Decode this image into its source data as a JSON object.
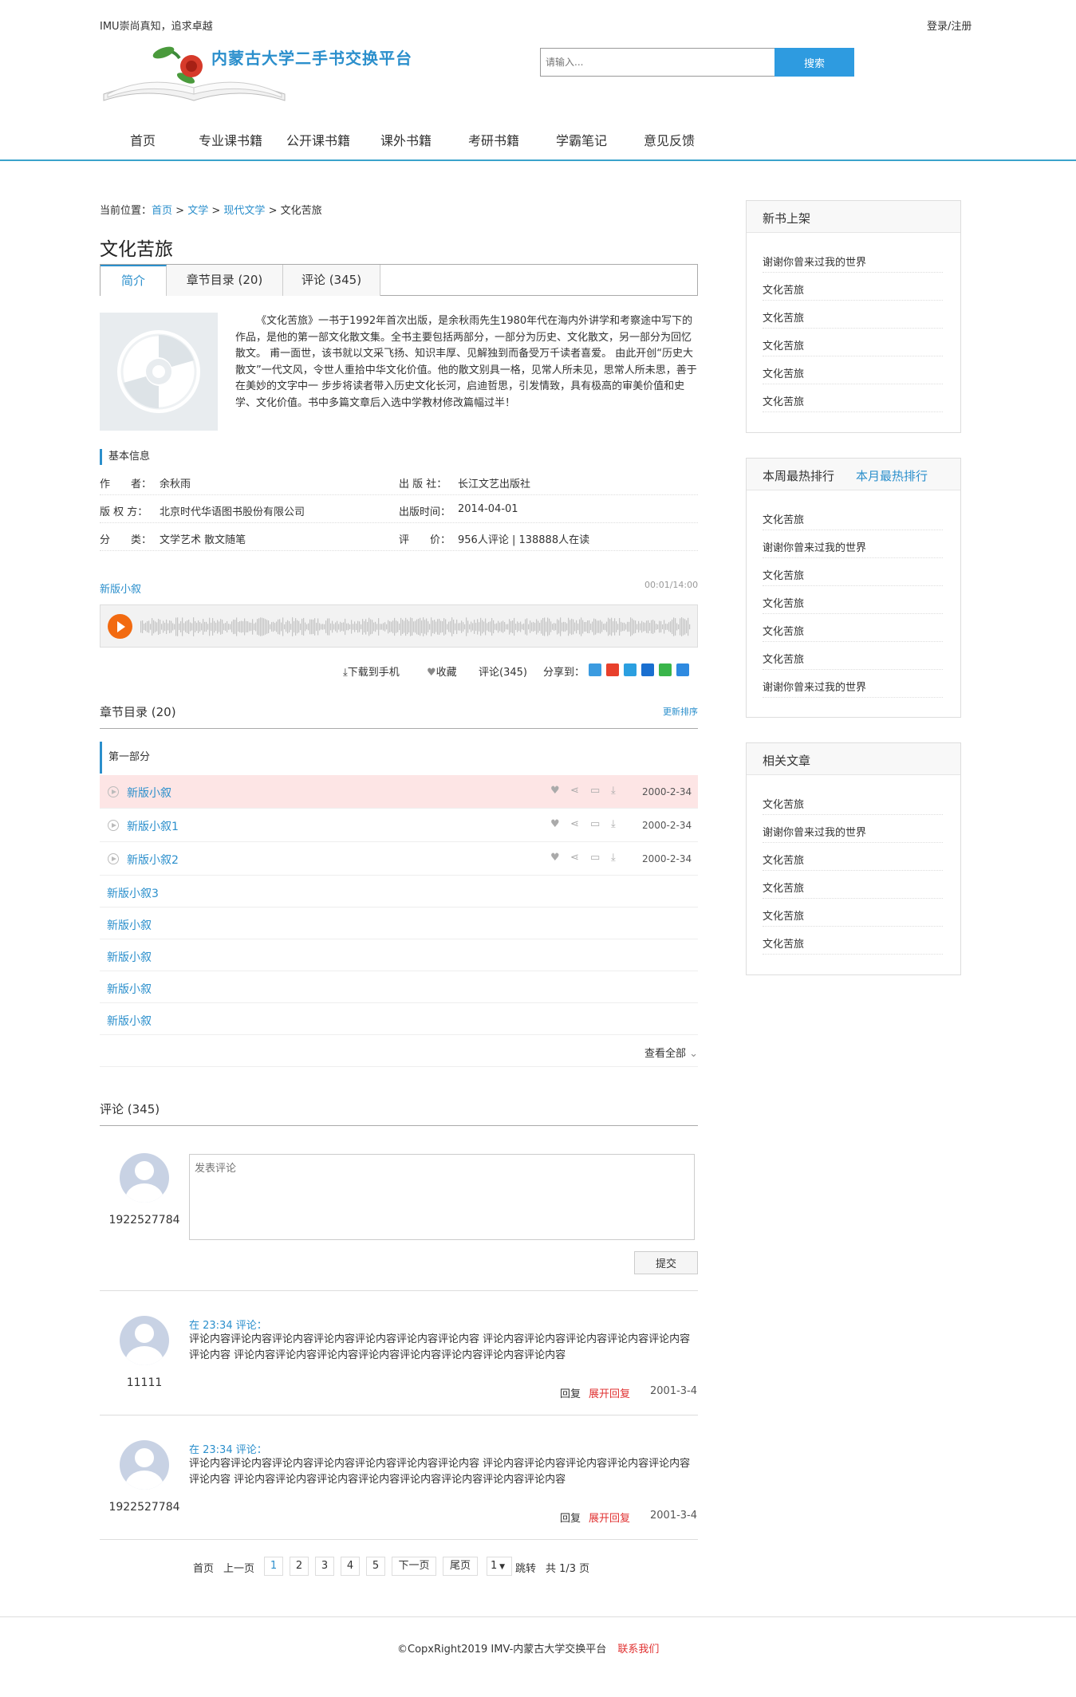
{
  "header": {
    "slogan": "IMU崇尚真知，追求卓越",
    "login": "登录/注册",
    "logo_title": "内蒙古大学二手书交换平台",
    "search_placeholder": "请输入...",
    "search_button": "搜索"
  },
  "nav": [
    "首页",
    "专业课书籍",
    "公开课书籍",
    "课外书籍",
    "考研书籍",
    "学霸笔记",
    "意见反馈"
  ],
  "breadcrumb": {
    "prefix": "当前位置：",
    "home": "首页",
    "cat1": "文学",
    "cat2": "现代文学",
    "current": "文化苦旅",
    "sep": ">"
  },
  "book": {
    "title": "文化苦旅",
    "tabs": [
      "简介",
      "章节目录 (20)",
      "评论 (345)"
    ],
    "description": "《文化苦旅》一书于1992年首次出版，是余秋雨先生1980年代在海内外讲学和考察途中写下的作品，是他的第一部文化散文集。全书主要包括两部分，一部分为历史、文化散文，另一部分为回忆散文。 甫一面世，该书就以文采飞扬、知识丰厚、见解独到而备受万千读者喜爱。 由此开创“历史大散文”一代文风，令世人重拾中华文化价值。他的散文别具一格，见常人所未见，思常人所未思，善于在美妙的文字中一 步步将读者带入历史文化长河，启迪哲思，引发情致，具有极高的审美价值和史学、文化价值。书中多篇文章后入选中学教材修改篇幅过半！",
    "basic_info_title": "基本信息",
    "info": {
      "author_label": "作　　者：",
      "author": "余秋雨",
      "publisher_label": "出 版 社：",
      "publisher": "长江文艺出版社",
      "copyright_label": "版 权 方：",
      "copyright": "北京时代华语图书股份有限公司",
      "date_label": "出版时间：",
      "date": "2014-04-01",
      "category_label": "分　　类：",
      "category": "文学艺术 散文随笔",
      "rating_label": "评　　价：",
      "rating": "956人评论 | 138888人在读"
    }
  },
  "audio": {
    "name": "新版小叙",
    "time": "00:01/14:00"
  },
  "actions": {
    "download": "下载到手机",
    "favorite": "收藏",
    "comments": "评论(345)",
    "share": "分享到："
  },
  "share_colors": [
    "#3b9be0",
    "#e8402c",
    "#2b9fe0",
    "#1a6fd0",
    "#3ab54a",
    "#2e8ae0"
  ],
  "chapters": {
    "title": "章节目录 (20)",
    "sort": "更新排序",
    "part": "第一部分",
    "rich": [
      {
        "name": "新版小叙",
        "date": "2000-2-34"
      },
      {
        "name": "新版小叙1",
        "date": "2000-2-34"
      },
      {
        "name": "新版小叙2",
        "date": "2000-2-34"
      }
    ],
    "plain": [
      "新版小叙3",
      "新版小叙",
      "新版小叙",
      "新版小叙",
      "新版小叙"
    ],
    "see_all": "查看全部"
  },
  "comments": {
    "title": "评论 (345)",
    "me": "1922527784",
    "placeholder": "发表评论",
    "submit": "提交",
    "list": [
      {
        "user": "11111",
        "head": "在 23:34 评论：",
        "body": "评论内容评论内容评论内容评论内容评论内容评论内容评论内容 评论内容评论内容评论内容评论内容评论内容评论内容 评论内容评论内容评论内容评论内容评论内容评论内容评论内容评论内容",
        "reply": "回复",
        "expand": "展开回复",
        "date": "2001-3-4"
      },
      {
        "user": "1922527784",
        "head": "在 23:34 评论：",
        "body": "评论内容评论内容评论内容评论内容评论内容评论内容评论内容 评论内容评论内容评论内容评论内容评论内容评论内容 评论内容评论内容评论内容评论内容评论内容评论内容评论内容评论内容",
        "reply": "回复",
        "expand": "展开回复",
        "date": "2001-3-4"
      }
    ]
  },
  "pager": {
    "first": "首页",
    "prev": "上一页",
    "pages": [
      "1",
      "2",
      "3",
      "4",
      "5"
    ],
    "current": "1",
    "next": "下一页",
    "last": "尾页",
    "jump_value": "1",
    "jump": "跳转",
    "total": "共 1/3 页"
  },
  "footer": {
    "copyright": "©CopxRight2019 IMV-内蒙古大学交换平台",
    "contact": "联系我们"
  },
  "sidebar": {
    "new_books": {
      "title": "新书上架",
      "items": [
        "谢谢你曾来过我的世界",
        "文化苦旅",
        "文化苦旅",
        "文化苦旅",
        "文化苦旅",
        "文化苦旅"
      ]
    },
    "ranking": {
      "tab_week": "本周最热排行",
      "tab_month": "本月最热排行",
      "items": [
        "文化苦旅",
        "谢谢你曾来过我的世界",
        "文化苦旅",
        "文化苦旅",
        "文化苦旅",
        "文化苦旅",
        "谢谢你曾来过我的世界"
      ]
    },
    "related": {
      "title": "相关文章",
      "items": [
        "文化苦旅",
        "谢谢你曾来过我的世界",
        "文化苦旅",
        "文化苦旅",
        "文化苦旅",
        "文化苦旅"
      ]
    }
  }
}
